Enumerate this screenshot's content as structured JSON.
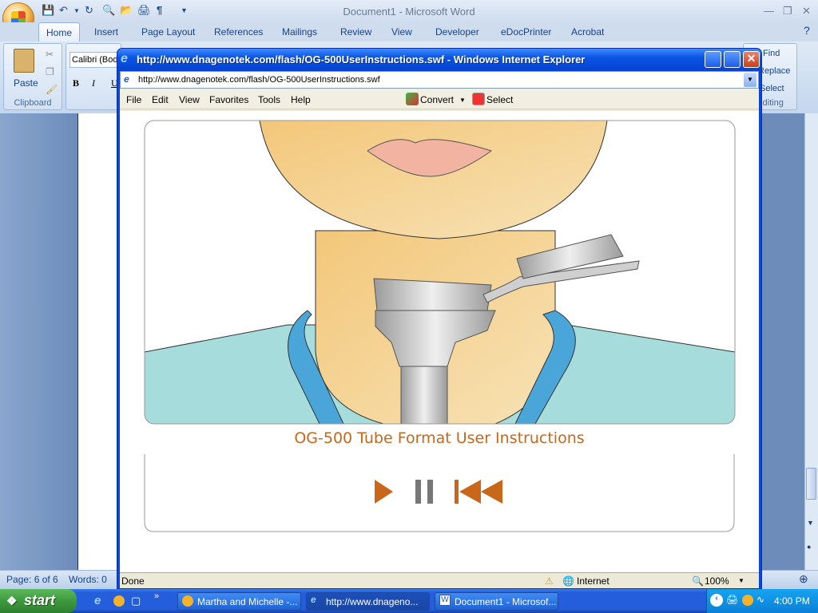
{
  "word": {
    "title": "Document1 - Microsoft Word",
    "tabs": [
      "Home",
      "Insert",
      "Page Layout",
      "References",
      "Mailings",
      "Review",
      "View",
      "Developer",
      "eDocPrinter",
      "Acrobat"
    ],
    "clipboard": {
      "paste": "Paste",
      "label": "Clipboard"
    },
    "font": {
      "name": "Calibri (Bod",
      "bold": "B",
      "italic": "I",
      "underline": "U"
    },
    "editing": {
      "find": "Find",
      "replace": "Replace",
      "select": "Select",
      "label": "Editing"
    },
    "status": {
      "page": "Page: 6 of 6",
      "words": "Words: 0"
    }
  },
  "ie": {
    "title": "http://www.dnagenotek.com/flash/OG-500UserInstructions.swf - Windows Internet Explorer",
    "address": "http://www.dnagenotek.com/flash/OG-500UserInstructions.swf",
    "menu": [
      "File",
      "Edit",
      "View",
      "Favorites",
      "Tools",
      "Help"
    ],
    "convert": "Convert",
    "select": "Select",
    "status": {
      "text": "Done",
      "zone": "Internet",
      "zoom": "100%"
    }
  },
  "flash": {
    "caption": "OG-500 Tube Format User Instructions",
    "accent": "#c8661a"
  },
  "taskbar": {
    "start": "start",
    "buttons": [
      "Martha and Michelle -...",
      "http://www.dnageno...",
      "Document1 - Microsof..."
    ],
    "clock": "4:00 PM"
  }
}
